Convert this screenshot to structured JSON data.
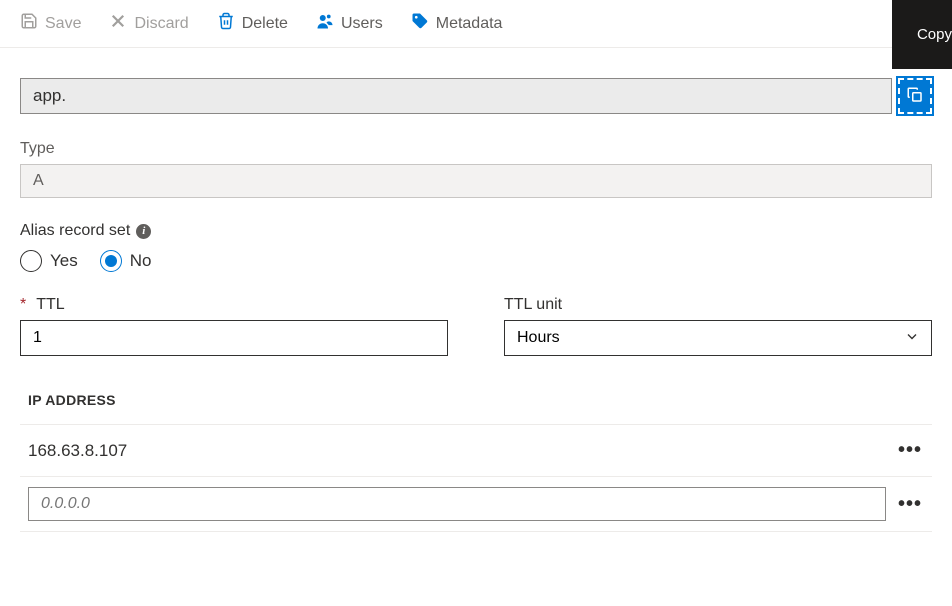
{
  "toolbar": {
    "save_label": "Save",
    "discard_label": "Discard",
    "delete_label": "Delete",
    "users_label": "Users",
    "metadata_label": "Metadata"
  },
  "copy_tooltip": "Copy",
  "record": {
    "name": "app.",
    "type_label": "Type",
    "type_value": "A",
    "alias_label": "Alias record set",
    "alias_options": {
      "yes": "Yes",
      "no": "No"
    },
    "alias_selected": "no",
    "ttl_label": "TTL",
    "ttl_value": "1",
    "ttl_unit_label": "TTL unit",
    "ttl_unit_value": "Hours"
  },
  "ip_section": {
    "header": "IP ADDRESS",
    "entries": [
      "168.63.8.107"
    ],
    "placeholder": "0.0.0.0"
  }
}
